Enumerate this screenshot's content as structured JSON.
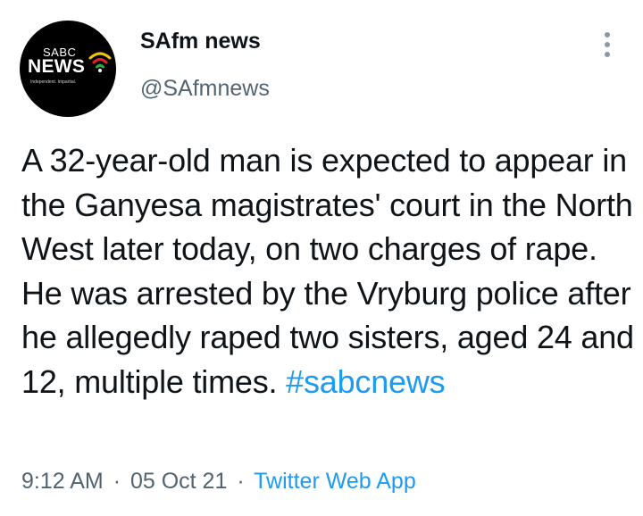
{
  "account": {
    "avatar": {
      "logo_top": "SABC",
      "logo_main": "NEWS",
      "logo_tagline": "Independent. Impartial.",
      "background": "#000000",
      "icon": "broadcast-waves-icon",
      "wave_colors": [
        "#f7c500",
        "#e5212e",
        "#2aa84a"
      ]
    },
    "display_name": "SAfm news",
    "handle": "@SAfmnews"
  },
  "menu": {
    "icon": "more-options-icon"
  },
  "tweet": {
    "text": "A 32-year-old man is expected to appear in the Ganyesa magistrates' court in the North West later today, on two charges of rape. He was arrested by the Vryburg police after he allegedly raped two sisters, aged 24 and 12, multiple times.",
    "hashtag": "#sabcnews"
  },
  "meta": {
    "time": "9:12 AM",
    "separator": "·",
    "date": "05 Oct 21",
    "source": "Twitter Web App"
  },
  "colors": {
    "link": "#1d9bf0",
    "secondary_text": "#536471",
    "primary_text": "#0f1419"
  }
}
